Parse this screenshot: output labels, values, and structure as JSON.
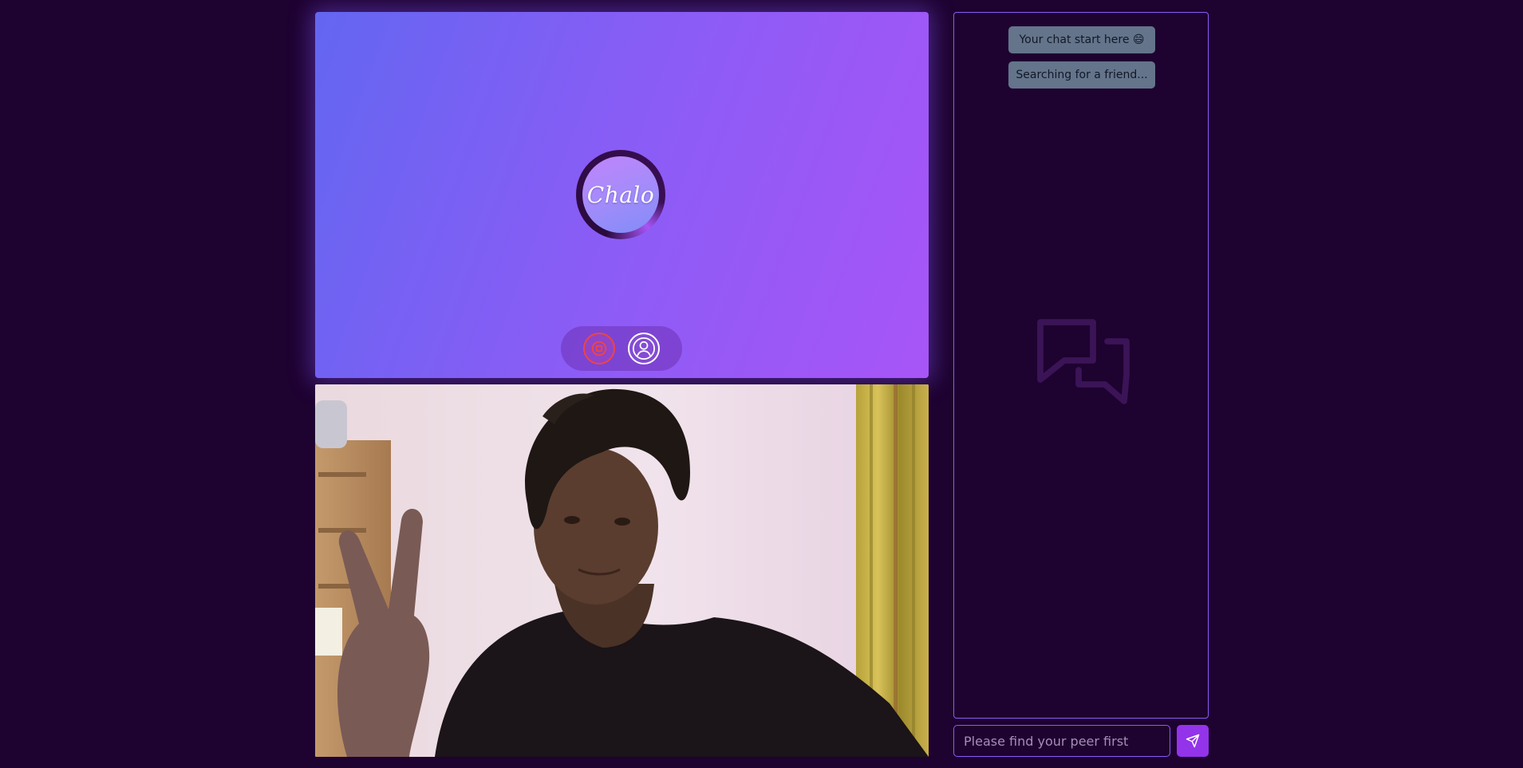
{
  "app": {
    "logo_text": "Chalo"
  },
  "remote_video": {
    "controls": {
      "stop_icon": "stop-circle-icon",
      "profile_icon": "user-circle-icon"
    }
  },
  "local_video": {
    "description_icon": "camera-feed"
  },
  "chat": {
    "messages": [
      {
        "text": "Your chat start here 😄"
      },
      {
        "text": "Searching for a friend..."
      }
    ],
    "watermark_icon": "chat-bubbles-icon",
    "input": {
      "placeholder": "Please find your peer first",
      "value": ""
    },
    "send_icon": "send-icon"
  },
  "colors": {
    "background": "#1e0230",
    "accent": "#8b5cf6",
    "send_button": "#9333ea",
    "stop_button": "#ef4444",
    "message_bubble": "#64748b"
  }
}
